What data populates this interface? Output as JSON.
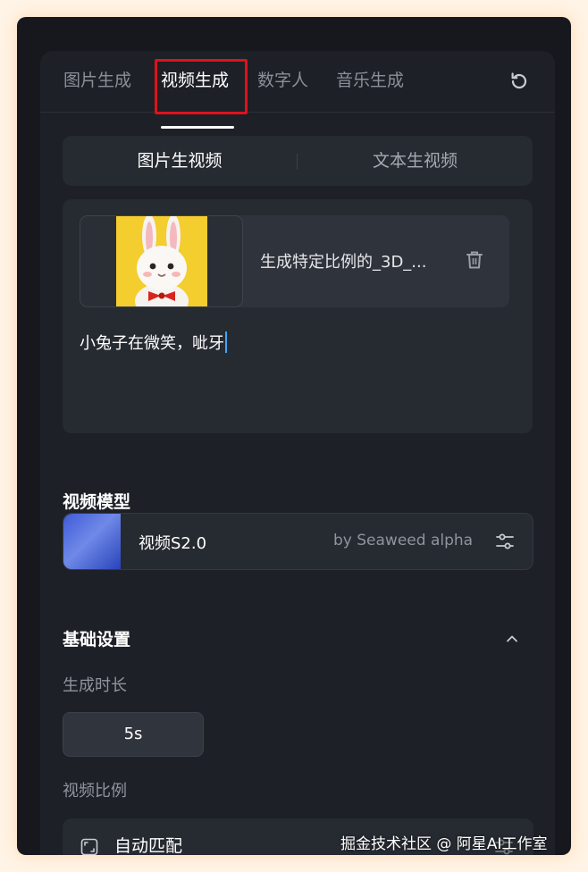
{
  "tabs": [
    {
      "label": "图片生成",
      "active": false
    },
    {
      "label": "视频生成",
      "active": true
    },
    {
      "label": "数字人",
      "active": false
    },
    {
      "label": "音乐生成",
      "active": false
    }
  ],
  "mode_switch": {
    "options": [
      "图片生视频",
      "文本生视频"
    ],
    "selected": "图片生视频"
  },
  "prompt_card": {
    "image_name": "生成特定比例的_3D_...",
    "prompt_text": "小兔子在微笑，呲牙"
  },
  "model_section": {
    "title": "视频模型",
    "model_name": "视频S2.0",
    "model_by": "by Seaweed alpha"
  },
  "basic_settings": {
    "title": "基础设置",
    "duration_label": "生成时长",
    "duration_value": "5s",
    "ratio_label": "视频比例",
    "ratio_value": "自动匹配"
  },
  "watermark": "掘金技术社区 @ 阿星AI工作室",
  "colors": {
    "accent_highlight": "#e0111b",
    "caret": "#3ea8ff",
    "background": "#16181d"
  },
  "icons": [
    "refresh-icon",
    "trash-icon",
    "settings-sliders-icon",
    "chevron-up-icon",
    "aspect-ratio-icon"
  ]
}
